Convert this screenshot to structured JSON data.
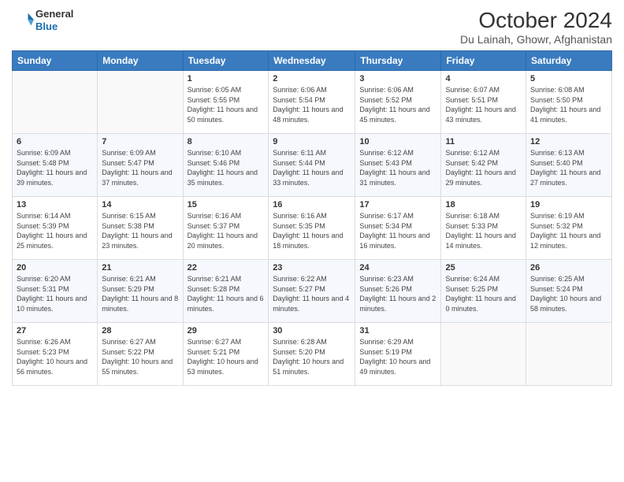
{
  "header": {
    "logo_line1": "General",
    "logo_line2": "Blue",
    "title": "October 2024",
    "subtitle": "Du Lainah, Ghowr, Afghanistan"
  },
  "weekdays": [
    "Sunday",
    "Monday",
    "Tuesday",
    "Wednesday",
    "Thursday",
    "Friday",
    "Saturday"
  ],
  "weeks": [
    [
      {
        "day": "",
        "info": ""
      },
      {
        "day": "",
        "info": ""
      },
      {
        "day": "1",
        "info": "Sunrise: 6:05 AM\nSunset: 5:55 PM\nDaylight: 11 hours and 50 minutes."
      },
      {
        "day": "2",
        "info": "Sunrise: 6:06 AM\nSunset: 5:54 PM\nDaylight: 11 hours and 48 minutes."
      },
      {
        "day": "3",
        "info": "Sunrise: 6:06 AM\nSunset: 5:52 PM\nDaylight: 11 hours and 45 minutes."
      },
      {
        "day": "4",
        "info": "Sunrise: 6:07 AM\nSunset: 5:51 PM\nDaylight: 11 hours and 43 minutes."
      },
      {
        "day": "5",
        "info": "Sunrise: 6:08 AM\nSunset: 5:50 PM\nDaylight: 11 hours and 41 minutes."
      }
    ],
    [
      {
        "day": "6",
        "info": "Sunrise: 6:09 AM\nSunset: 5:48 PM\nDaylight: 11 hours and 39 minutes."
      },
      {
        "day": "7",
        "info": "Sunrise: 6:09 AM\nSunset: 5:47 PM\nDaylight: 11 hours and 37 minutes."
      },
      {
        "day": "8",
        "info": "Sunrise: 6:10 AM\nSunset: 5:46 PM\nDaylight: 11 hours and 35 minutes."
      },
      {
        "day": "9",
        "info": "Sunrise: 6:11 AM\nSunset: 5:44 PM\nDaylight: 11 hours and 33 minutes."
      },
      {
        "day": "10",
        "info": "Sunrise: 6:12 AM\nSunset: 5:43 PM\nDaylight: 11 hours and 31 minutes."
      },
      {
        "day": "11",
        "info": "Sunrise: 6:12 AM\nSunset: 5:42 PM\nDaylight: 11 hours and 29 minutes."
      },
      {
        "day": "12",
        "info": "Sunrise: 6:13 AM\nSunset: 5:40 PM\nDaylight: 11 hours and 27 minutes."
      }
    ],
    [
      {
        "day": "13",
        "info": "Sunrise: 6:14 AM\nSunset: 5:39 PM\nDaylight: 11 hours and 25 minutes."
      },
      {
        "day": "14",
        "info": "Sunrise: 6:15 AM\nSunset: 5:38 PM\nDaylight: 11 hours and 23 minutes."
      },
      {
        "day": "15",
        "info": "Sunrise: 6:16 AM\nSunset: 5:37 PM\nDaylight: 11 hours and 20 minutes."
      },
      {
        "day": "16",
        "info": "Sunrise: 6:16 AM\nSunset: 5:35 PM\nDaylight: 11 hours and 18 minutes."
      },
      {
        "day": "17",
        "info": "Sunrise: 6:17 AM\nSunset: 5:34 PM\nDaylight: 11 hours and 16 minutes."
      },
      {
        "day": "18",
        "info": "Sunrise: 6:18 AM\nSunset: 5:33 PM\nDaylight: 11 hours and 14 minutes."
      },
      {
        "day": "19",
        "info": "Sunrise: 6:19 AM\nSunset: 5:32 PM\nDaylight: 11 hours and 12 minutes."
      }
    ],
    [
      {
        "day": "20",
        "info": "Sunrise: 6:20 AM\nSunset: 5:31 PM\nDaylight: 11 hours and 10 minutes."
      },
      {
        "day": "21",
        "info": "Sunrise: 6:21 AM\nSunset: 5:29 PM\nDaylight: 11 hours and 8 minutes."
      },
      {
        "day": "22",
        "info": "Sunrise: 6:21 AM\nSunset: 5:28 PM\nDaylight: 11 hours and 6 minutes."
      },
      {
        "day": "23",
        "info": "Sunrise: 6:22 AM\nSunset: 5:27 PM\nDaylight: 11 hours and 4 minutes."
      },
      {
        "day": "24",
        "info": "Sunrise: 6:23 AM\nSunset: 5:26 PM\nDaylight: 11 hours and 2 minutes."
      },
      {
        "day": "25",
        "info": "Sunrise: 6:24 AM\nSunset: 5:25 PM\nDaylight: 11 hours and 0 minutes."
      },
      {
        "day": "26",
        "info": "Sunrise: 6:25 AM\nSunset: 5:24 PM\nDaylight: 10 hours and 58 minutes."
      }
    ],
    [
      {
        "day": "27",
        "info": "Sunrise: 6:26 AM\nSunset: 5:23 PM\nDaylight: 10 hours and 56 minutes."
      },
      {
        "day": "28",
        "info": "Sunrise: 6:27 AM\nSunset: 5:22 PM\nDaylight: 10 hours and 55 minutes."
      },
      {
        "day": "29",
        "info": "Sunrise: 6:27 AM\nSunset: 5:21 PM\nDaylight: 10 hours and 53 minutes."
      },
      {
        "day": "30",
        "info": "Sunrise: 6:28 AM\nSunset: 5:20 PM\nDaylight: 10 hours and 51 minutes."
      },
      {
        "day": "31",
        "info": "Sunrise: 6:29 AM\nSunset: 5:19 PM\nDaylight: 10 hours and 49 minutes."
      },
      {
        "day": "",
        "info": ""
      },
      {
        "day": "",
        "info": ""
      }
    ]
  ]
}
